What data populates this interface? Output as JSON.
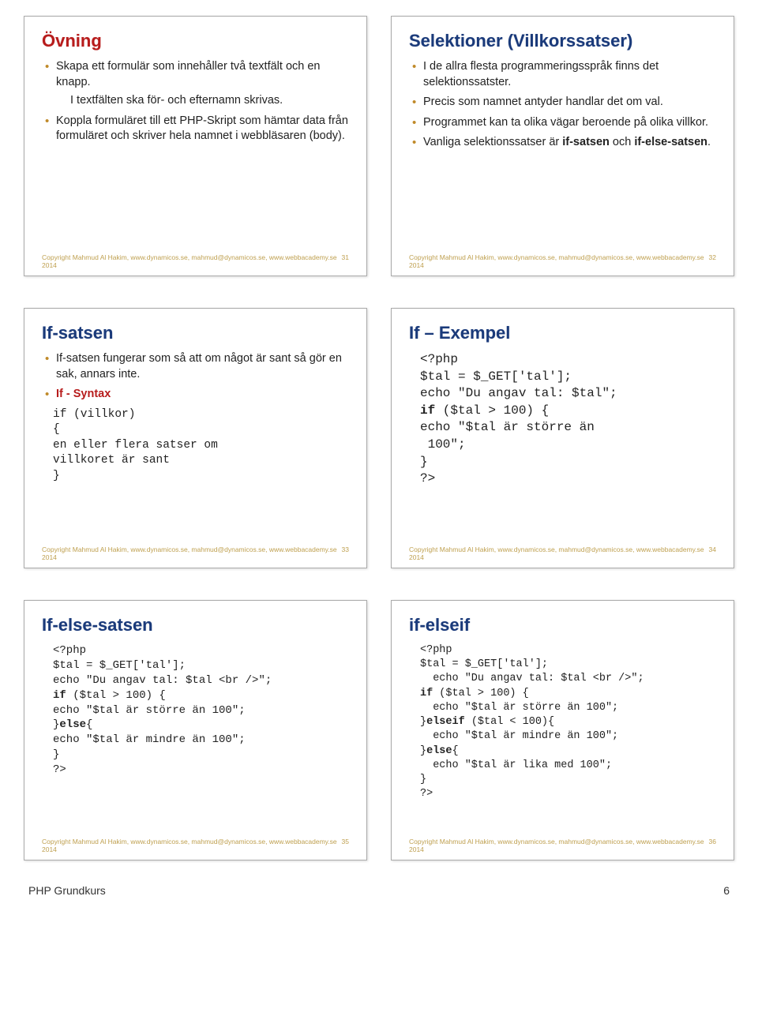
{
  "footer_text": "Copyright Mahmud Al Hakim, www.dynamicos.se, mahmud@dynamicos.se, www.webbacademy.se 2014",
  "page_footer": {
    "left": "PHP Grundkurs",
    "right": "6"
  },
  "slides": [
    {
      "title": "Övning",
      "num": "31",
      "b1": "Skapa ett formulär som innehåller två textfält och en knapp.",
      "b1s": "I textfälten ska för- och efternamn skrivas.",
      "b2": "Koppla formuläret till ett PHP-Skript som hämtar data från formuläret och skriver hela namnet i webbläsaren (body)."
    },
    {
      "title": "Selektioner (Villkorssatser)",
      "num": "32",
      "b1": "I de allra flesta programmeringsspråk finns det selektionssatster.",
      "b2": "Precis som namnet antyder handlar det om val.",
      "b3": "Programmet kan ta olika vägar beroende på olika villkor.",
      "b4_pre": "Vanliga selektionssatser är ",
      "b4_bold1": "if-satsen",
      "b4_mid": " och ",
      "b4_bold2": "if-else-satsen",
      "b4_post": "."
    },
    {
      "title": "If-satsen",
      "num": "33",
      "b1": "If-satsen fungerar som så att om något är sant så gör en sak, annars inte.",
      "b2": "If - Syntax",
      "code": "if (villkor)\n{\nen eller flera satser om\nvillkoret är sant\n}"
    },
    {
      "title": "If – Exempel",
      "num": "34",
      "l1": "<?php",
      "l2": "$tal = $_GET['tal'];",
      "l3": "echo \"Du angav tal: $tal\";",
      "l4a": "if",
      "l4b": " ($tal > 100) {",
      "l5": "echo \"$tal är större än\n 100\";",
      "l6": "}",
      "l7": "?>"
    },
    {
      "title": "If-else-satsen",
      "num": "35",
      "code_pre": "<?php\n$tal = $_GET['tal'];\necho \"Du angav tal: $tal <br />\";\n",
      "kw1": "if",
      "code_mid1": " ($tal > 100) {\necho \"$tal är större än 100\";\n}",
      "kw2": "else",
      "code_post": "{\necho \"$tal är mindre än 100\";\n}\n?>"
    },
    {
      "title": "if-elseif",
      "num": "36",
      "l1": "<?php",
      "l2": "$tal = $_GET['tal'];",
      "l3": "  echo \"Du angav tal: $tal <br />\";",
      "kw1": "if",
      "l4": " ($tal > 100) {",
      "l5": "  echo \"$tal är större än 100\";",
      "l6a": "}",
      "kw2": "elseif",
      "l6b": " ($tal < 100){",
      "l7": "  echo \"$tal är mindre än 100\";",
      "l8a": "}",
      "kw3": "else",
      "l8b": "{",
      "l9": "  echo \"$tal är lika med 100\";",
      "l10": "}",
      "l11": "?>"
    }
  ]
}
